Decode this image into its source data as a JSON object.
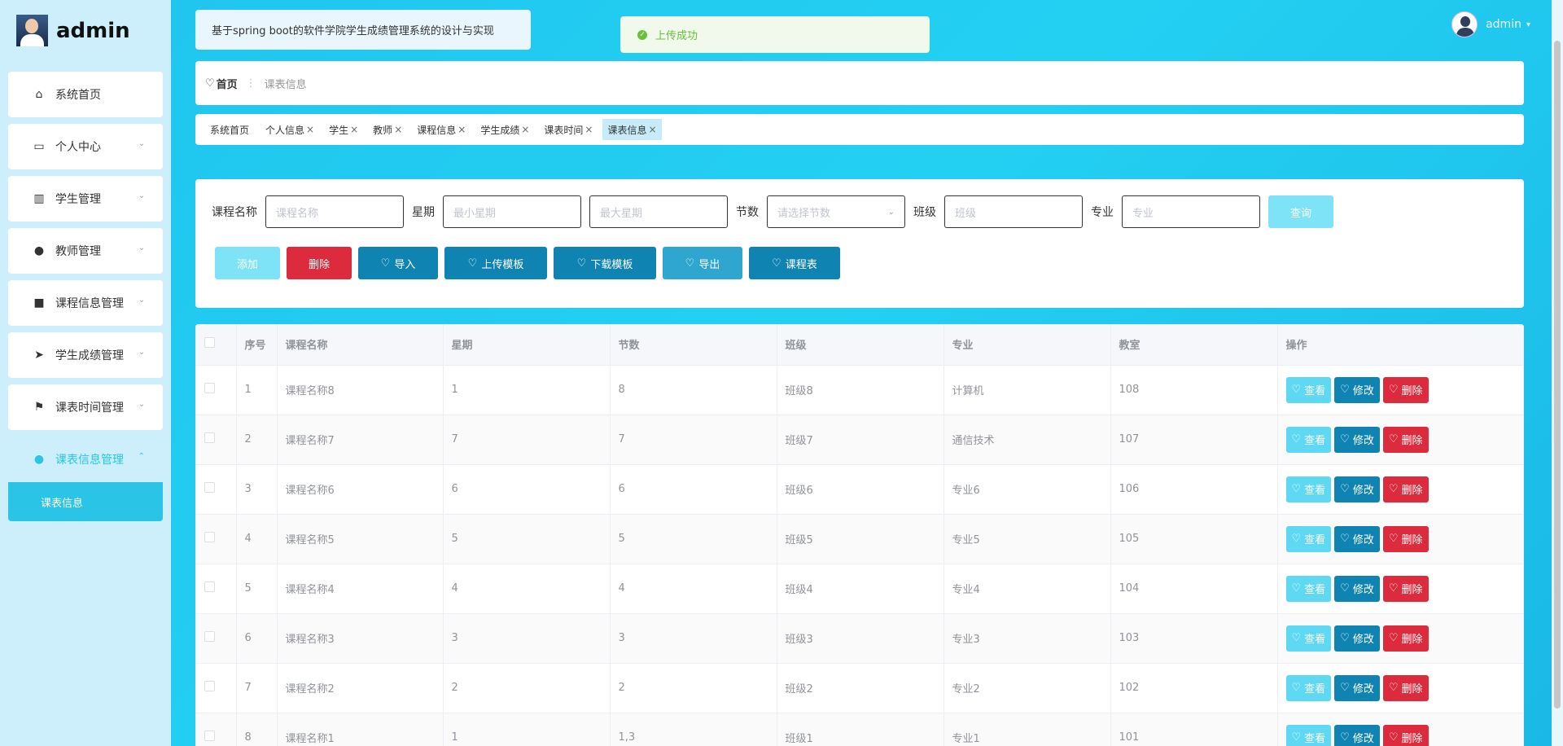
{
  "brand": {
    "title": "admin"
  },
  "sidebar": {
    "items": [
      {
        "label": "系统首页",
        "icon": "home-icon",
        "glyph": "⌂",
        "chevron": ""
      },
      {
        "label": "个人中心",
        "icon": "card-icon",
        "glyph": "▭",
        "chevron": "⌄"
      },
      {
        "label": "学生管理",
        "icon": "books-icon",
        "glyph": "▥",
        "chevron": "⌄"
      },
      {
        "label": "教师管理",
        "icon": "person-icon",
        "glyph": "●",
        "chevron": "⌄"
      },
      {
        "label": "课程信息管理",
        "icon": "grid-icon",
        "glyph": "■",
        "chevron": "⌄"
      },
      {
        "label": "学生成绩管理",
        "icon": "send-icon",
        "glyph": "➤",
        "chevron": "⌄"
      },
      {
        "label": "课表时间管理",
        "icon": "flag-icon",
        "glyph": "⚑",
        "chevron": "⌄"
      },
      {
        "label": "课表信息管理",
        "icon": "pin-icon",
        "glyph": "●",
        "chevron": "⌃"
      }
    ],
    "submenu": {
      "label": "课表信息"
    }
  },
  "header": {
    "title": "基于spring boot的软件学院学生成绩管理系统的设计与实现",
    "toast": "上传成功",
    "user": "admin"
  },
  "breadcrumb": {
    "home": "首页",
    "sep": "⋮",
    "current": "课表信息"
  },
  "tags": [
    {
      "label": "系统首页",
      "close": ""
    },
    {
      "label": "个人信息",
      "close": "×"
    },
    {
      "label": "学生",
      "close": "×"
    },
    {
      "label": "教师",
      "close": "×"
    },
    {
      "label": "课程信息",
      "close": "×"
    },
    {
      "label": "学生成绩",
      "close": "×"
    },
    {
      "label": "课表时间",
      "close": "×"
    },
    {
      "label": "课表信息",
      "close": "×"
    }
  ],
  "search": {
    "course_label": "课程名称",
    "course_placeholder": "课程名称",
    "week_label": "星期",
    "week_min_placeholder": "最小星期",
    "week_max_placeholder": "最大星期",
    "section_label": "节数",
    "section_placeholder": "请选择节数",
    "class_label": "班级",
    "class_placeholder": "班级",
    "major_label": "专业",
    "major_placeholder": "专业",
    "query_label": "查询"
  },
  "actions": {
    "add": "添加",
    "delete": "删除",
    "import": "导入",
    "upload_template": "上传模板",
    "download_template": "下载模板",
    "export": "导出",
    "schedule": "课程表"
  },
  "table": {
    "headers": [
      "序号",
      "课程名称",
      "星期",
      "节数",
      "班级",
      "专业",
      "教室",
      "操作"
    ],
    "rows": [
      [
        "1",
        "课程名称8",
        "1",
        "8",
        "班级8",
        "计算机",
        "108"
      ],
      [
        "2",
        "课程名称7",
        "7",
        "7",
        "班级7",
        "通信技术",
        "107"
      ],
      [
        "3",
        "课程名称6",
        "6",
        "6",
        "班级6",
        "专业6",
        "106"
      ],
      [
        "4",
        "课程名称5",
        "5",
        "5",
        "班级5",
        "专业5",
        "105"
      ],
      [
        "5",
        "课程名称4",
        "4",
        "4",
        "班级4",
        "专业4",
        "104"
      ],
      [
        "6",
        "课程名称3",
        "3",
        "3",
        "班级3",
        "专业3",
        "103"
      ],
      [
        "7",
        "课程名称2",
        "2",
        "2",
        "班级2",
        "专业2",
        "102"
      ],
      [
        "8",
        "课程名称1",
        "1",
        "1,3",
        "班级1",
        "专业1",
        "101"
      ]
    ],
    "op_view": "查看",
    "op_edit": "修改",
    "op_delete": "删除"
  },
  "colors": {
    "accent": "#29c4e6",
    "dark_blue": "#0f83b2",
    "red": "#dd2b3e",
    "light_blue": "#5ed8f3"
  }
}
